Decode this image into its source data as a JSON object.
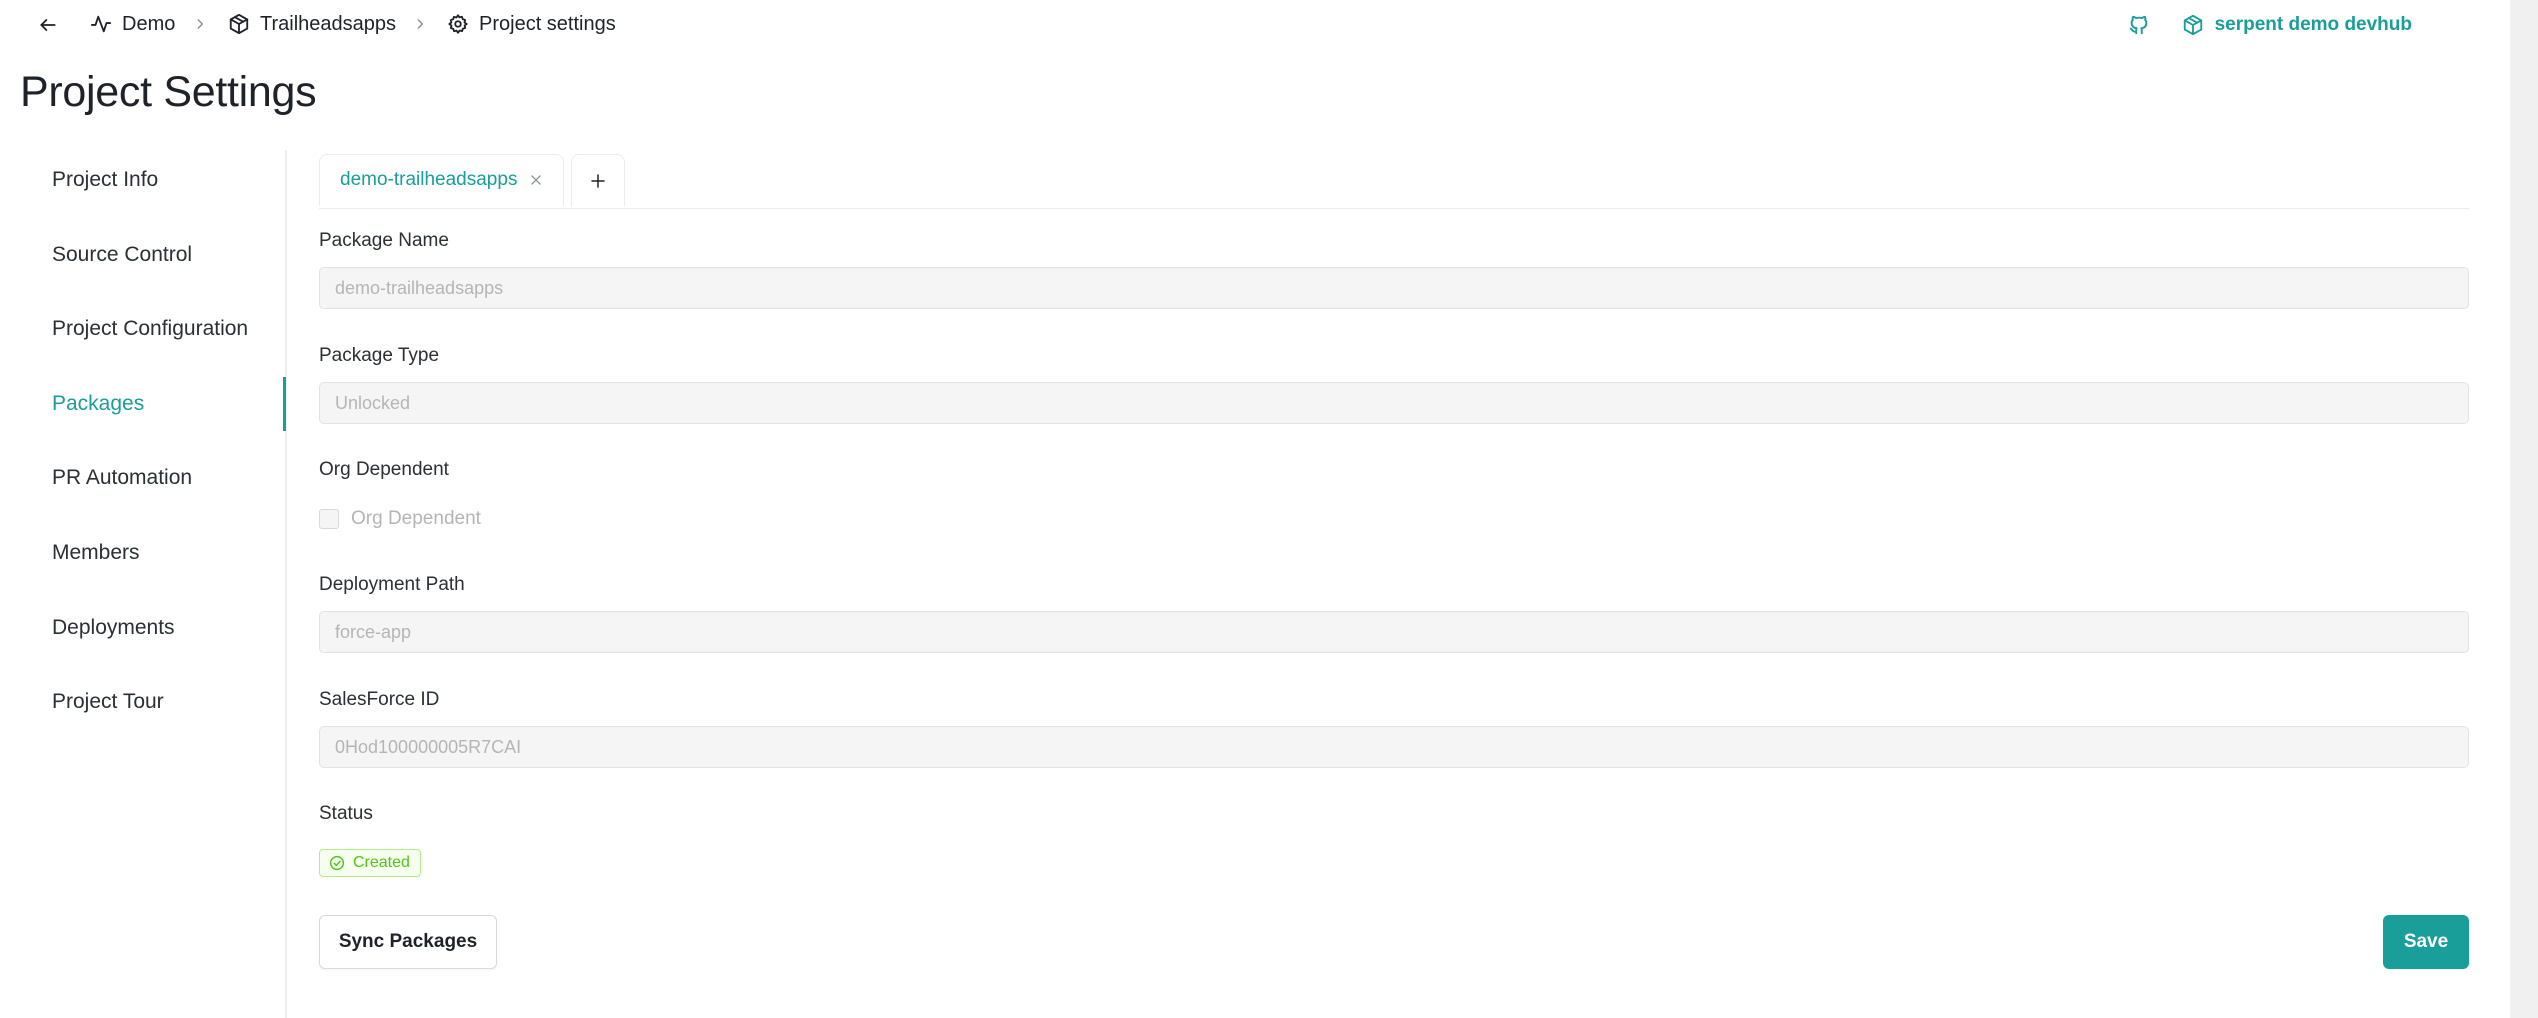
{
  "breadcrumb": {
    "items": [
      {
        "label": "Demo",
        "icon": "activity-icon"
      },
      {
        "label": "Trailheadsapps",
        "icon": "package-icon"
      },
      {
        "label": "Project settings",
        "icon": "gear-icon"
      }
    ],
    "separator": "chevron-right-icon"
  },
  "header": {
    "github_icon": "github-icon",
    "workspace_name": "serpent demo devhub",
    "workspace_icon": "package-icon"
  },
  "page_title": "Project Settings",
  "sidebar": {
    "items": [
      {
        "label": "Project Info"
      },
      {
        "label": "Source Control"
      },
      {
        "label": "Project Configuration"
      },
      {
        "label": "Packages",
        "active": true
      },
      {
        "label": "PR Automation"
      },
      {
        "label": "Members"
      },
      {
        "label": "Deployments"
      },
      {
        "label": "Project Tour"
      }
    ]
  },
  "tabs": {
    "items": [
      {
        "label": "demo-trailheadsapps",
        "active": true
      }
    ],
    "add_icon": "plus-icon"
  },
  "form": {
    "package_name": {
      "label": "Package Name",
      "value": "demo-trailheadsapps"
    },
    "package_type": {
      "label": "Package Type",
      "value": "Unlocked"
    },
    "org_dependent": {
      "label": "Org Dependent",
      "checkbox_label": "Org Dependent",
      "checked": false
    },
    "deployment_path": {
      "label": "Deployment Path",
      "value": "force-app"
    },
    "salesforce_id": {
      "label": "SalesForce ID",
      "value": "0Hod100000005R7CAI"
    },
    "status": {
      "label": "Status",
      "value": "Created"
    }
  },
  "actions": {
    "sync_label": "Sync Packages",
    "save_label": "Save"
  },
  "colors": {
    "accent": "#1a9e9a",
    "status_success": "#52c41a"
  }
}
